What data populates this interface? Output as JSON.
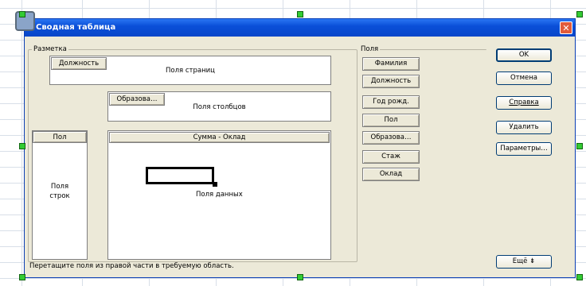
{
  "dialog": {
    "title": "Сводная таблица",
    "close_glyph": "✕"
  },
  "layout_group": {
    "label": "Разметка",
    "page_fields_label": "Поля страниц",
    "column_fields_label": "Поля столбцов",
    "row_fields_label_line1": "Поля",
    "row_fields_label_line2": "строк",
    "data_fields_label": "Поля данных",
    "page_field_button": "Должность",
    "column_field_button": "Образова…",
    "row_field_button": "Пол",
    "data_field_button": "Сумма - Оклад"
  },
  "fields_group": {
    "label": "Поля",
    "items": [
      "Фамилия",
      "Должность",
      "Год рожд.",
      "Пол",
      "Образова…",
      "Стаж",
      "Оклад"
    ]
  },
  "buttons": {
    "ok": "OK",
    "cancel": "Отмена",
    "help": "Справка",
    "delete": "Удалить",
    "params": "Параметры…",
    "more": "Ещё ⇟"
  },
  "status": "Перетащите поля из правой части в требуемую область.",
  "colors": {
    "title_bar": "#0a4fd8",
    "dialog_bg": "#ece9d8",
    "handle": "#33cc33"
  },
  "icons": {
    "close": "close-icon",
    "app": "app-icon"
  }
}
